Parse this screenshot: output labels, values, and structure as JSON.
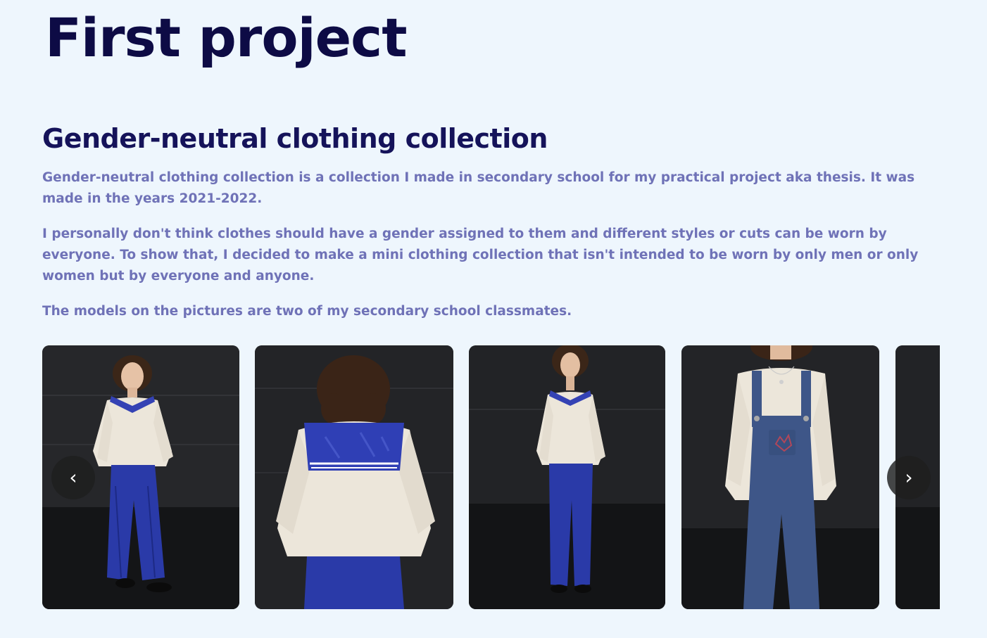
{
  "page": {
    "title": "First project"
  },
  "project": {
    "heading": "Gender-neutral clothing collection",
    "paragraphs": [
      "Gender-neutral clothing collection is a collection I made in secondary school for my practical project aka thesis. It was made in the years 2021-2022.",
      "I personally don't think clothes should have a gender assigned to them and different styles or cuts can be worn by everyone. To show that, I decided to make a mini clothing collection that isn't intended to be worn by only men or only women but by everyone and anyone.",
      "The models on the pictures are two of my secondary school classmates."
    ]
  },
  "carousel": {
    "prev_icon": "‹",
    "next_icon": "›",
    "slides": [
      {
        "subject": "model-front-sailor-top-blue-corduroy-pants"
      },
      {
        "subject": "model-back-sailor-collar"
      },
      {
        "subject": "model-front-sailor-top-blue-pants"
      },
      {
        "subject": "model-denim-overalls-closeup"
      },
      {
        "subject": "partial-next-slide"
      }
    ]
  },
  "colors": {
    "background": "#eef6fd",
    "title": "#0d0b45",
    "heading": "#15135a",
    "body_text": "#6f72b7",
    "sailor_collar": "#2f3fb5",
    "corduroy": "#2a3aa8",
    "denim": "#3e5688",
    "top": "#ece6da"
  }
}
